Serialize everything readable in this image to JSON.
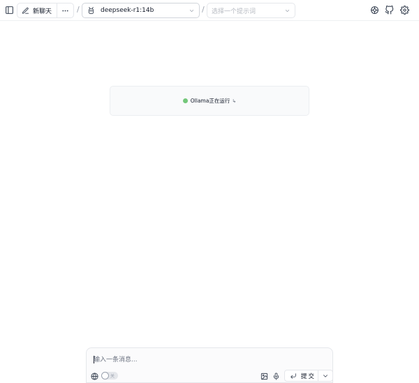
{
  "header": {
    "new_chat_label": "新聊天",
    "model": {
      "selected": "deepseek-r1:14b"
    },
    "prompt": {
      "placeholder": "选择一个提示词"
    },
    "separator": "/"
  },
  "status": {
    "text": "Ollama正在运行",
    "link_glyph": "↳",
    "indicator_color": "#74c77a"
  },
  "composer": {
    "placeholder": "输入一条消息...",
    "web_toggle": {
      "state_label": "关",
      "on": false
    },
    "submit_label": "提交"
  },
  "icons": {
    "sidebar": "sidebar-toggle-icon",
    "new_chat": "edit-icon",
    "more": "ellipsis-icon",
    "model": "robot-icon",
    "chevron": "chevron-down-icon",
    "brain": "brain-icon",
    "github": "github-icon",
    "settings": "gear-icon",
    "web": "globe-icon",
    "image": "image-icon",
    "mic": "microphone-icon",
    "enter": "enter-icon"
  }
}
